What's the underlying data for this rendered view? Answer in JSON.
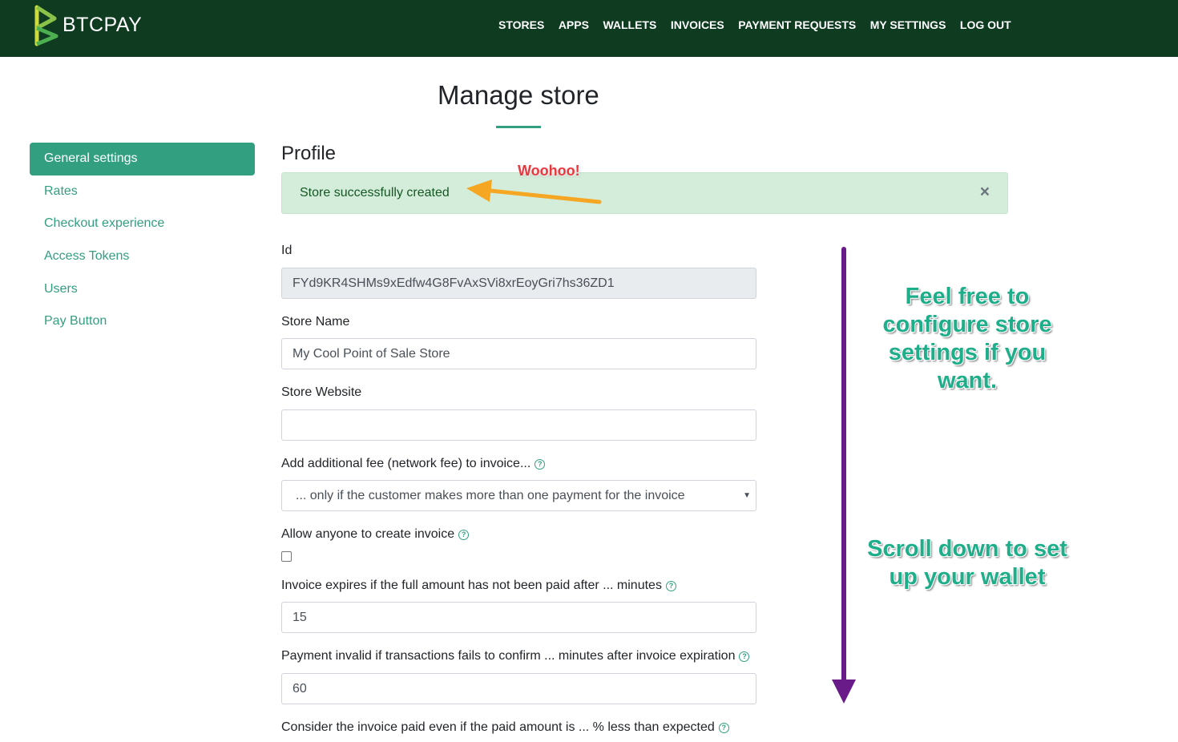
{
  "brand": {
    "name": "BTCPAY"
  },
  "nav": {
    "items": [
      "STORES",
      "APPS",
      "WALLETS",
      "INVOICES",
      "PAYMENT REQUESTS",
      "MY SETTINGS",
      "LOG OUT"
    ]
  },
  "page": {
    "title": "Manage store",
    "section": "Profile"
  },
  "sidebar": {
    "items": [
      "General settings",
      "Rates",
      "Checkout experience",
      "Access Tokens",
      "Users",
      "Pay Button"
    ]
  },
  "alert": {
    "text": "Store successfully created",
    "close": "×"
  },
  "form": {
    "id_label": "Id",
    "id_value": "FYd9KR4SHMs9xEdfw4G8FvAxSVi8xrEoyGri7hs36ZD1",
    "name_label": "Store Name",
    "name_value": "My Cool Point of Sale Store",
    "website_label": "Store Website",
    "website_value": "",
    "fee_label": "Add additional fee (network fee) to invoice...",
    "fee_value": "... only if the customer makes more than one payment for the invoice",
    "anyone_label": "Allow anyone to create invoice",
    "expire_label": "Invoice expires if the full amount has not been paid after ... minutes",
    "expire_value": "15",
    "invalid_label": "Payment invalid if transactions fails to confirm ... minutes after invoice expiration",
    "invalid_value": "60",
    "paid_label": "Consider the invoice paid even if the paid amount is ... % less than expected"
  },
  "annotations": {
    "woohoo": "Woohoo!",
    "configure": "Feel free to configure store settings if you want.",
    "scroll": "Scroll down to set up your wallet"
  },
  "colors": {
    "navbar": "#0f3b21",
    "accent": "#329f80",
    "alert_bg": "#d4edda",
    "arrow_orange": "#f5a623",
    "arrow_purple": "#6a1b8a"
  },
  "icons": {
    "help": "question-circle-icon",
    "caret": "caret-down-icon",
    "close": "close-icon"
  }
}
